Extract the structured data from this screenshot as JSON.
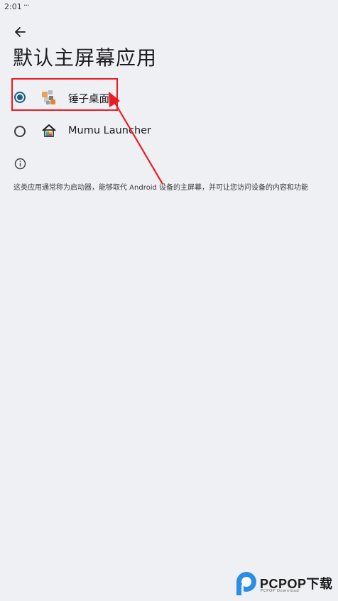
{
  "status_bar": {
    "time": "2:01",
    "indicator": "···"
  },
  "header": {
    "title": "默认主屏幕应用",
    "back_icon": "arrow-back-icon"
  },
  "options": [
    {
      "label": "锤子桌面",
      "selected": true,
      "icon": "smartisan-launcher-icon"
    },
    {
      "label": "Mumu Launcher",
      "selected": false,
      "icon": "mumu-house-icon"
    }
  ],
  "info": {
    "icon": "info-icon",
    "text": "这类应用通常称为启动器，能够取代 Android 设备的主屏幕，并可让您访问设备的内容和功能"
  },
  "annotation": {
    "color": "#ee1b24"
  },
  "accent": "#1d5f86",
  "watermark": {
    "brand": "PCPOP下载",
    "sub": "PCPOP Download"
  }
}
